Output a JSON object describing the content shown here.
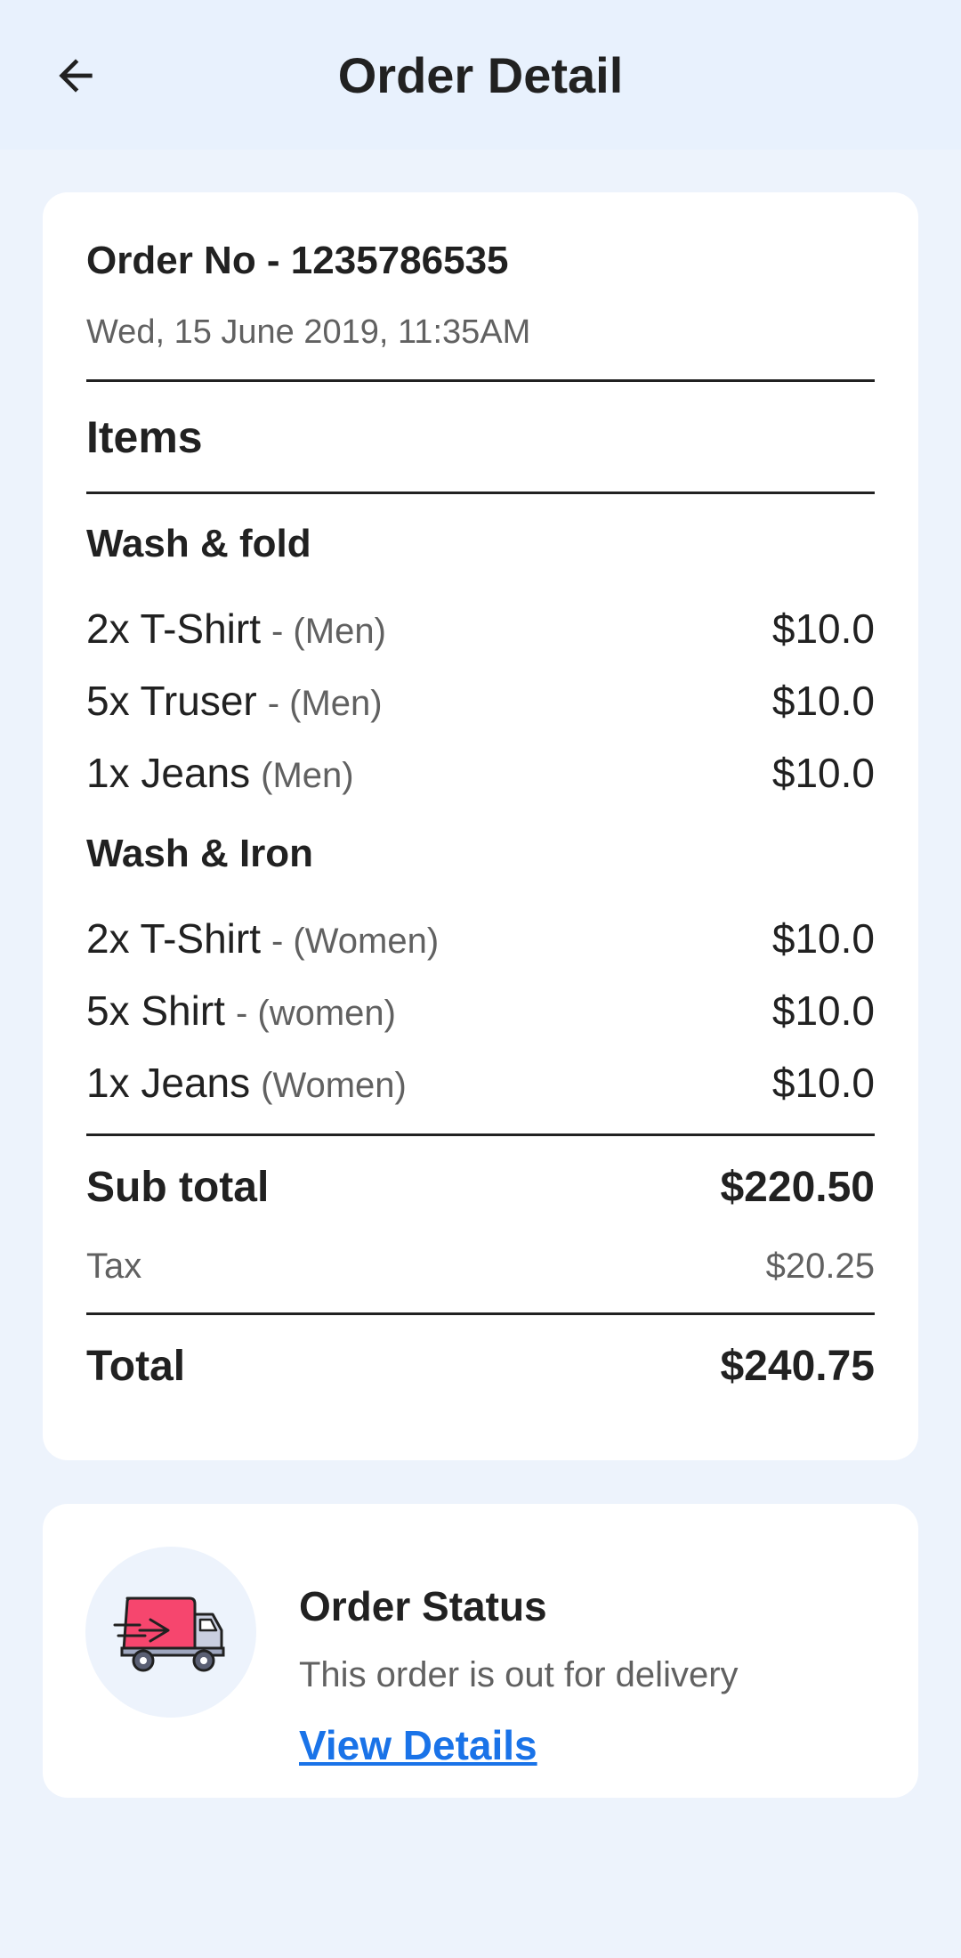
{
  "appbar": {
    "title": "Order Detail"
  },
  "order": {
    "number": "Order No - 1235786535",
    "date": "Wed, 15 June 2019, 11:35AM",
    "items_title": "Items",
    "sections": [
      {
        "title": "Wash & fold",
        "items": [
          {
            "name": "2x T-Shirt",
            "category": "- (Men)",
            "price": "$10.0"
          },
          {
            "name": "5x Truser",
            "category": "- (Men)",
            "price": "$10.0"
          },
          {
            "name": "1x Jeans",
            "category": "(Men)",
            "price": "$10.0"
          }
        ]
      },
      {
        "title": "Wash & Iron",
        "items": [
          {
            "name": "2x T-Shirt",
            "category": "- (Women)",
            "price": "$10.0"
          },
          {
            "name": "5x Shirt",
            "category": "- (women)",
            "price": "$10.0"
          },
          {
            "name": "1x Jeans",
            "category": "(Women)",
            "price": "$10.0"
          }
        ]
      }
    ],
    "subtotal_label": "Sub total",
    "subtotal_value": "$220.50",
    "tax_label": "Tax",
    "tax_value": "$20.25",
    "total_label": "Total",
    "total_value": "$240.75"
  },
  "status": {
    "icon": "delivery-truck-icon",
    "title": "Order Status",
    "text": "This order is out for delivery",
    "link": "View Details"
  },
  "colors": {
    "background": "#EDF3FC",
    "appbar": "#E8F1FD",
    "card": "#FFFFFF",
    "link": "#1A73E8",
    "truck": "#F6466E"
  }
}
